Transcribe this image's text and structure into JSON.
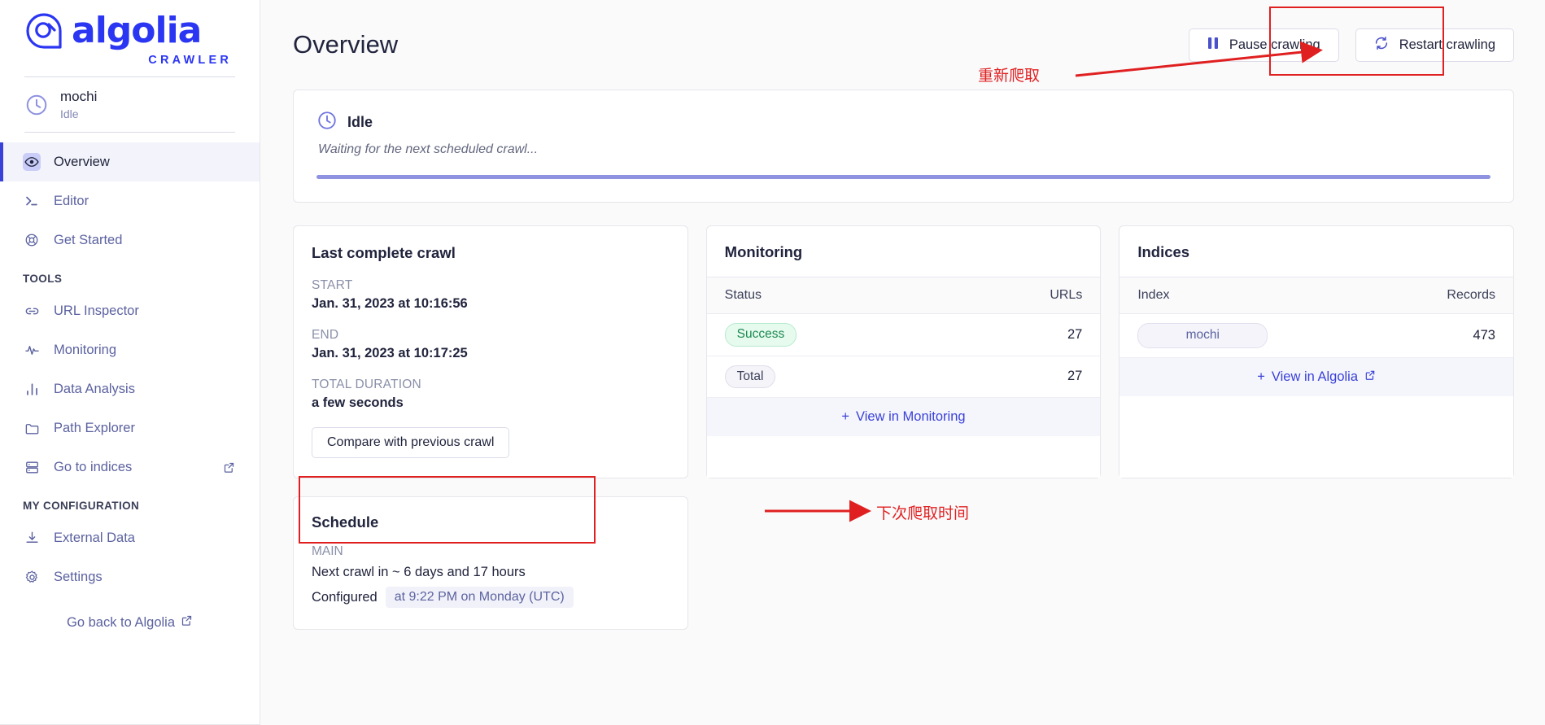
{
  "sidebar": {
    "logo_word": "algolia",
    "logo_sub": "CRAWLER",
    "crawler": {
      "name": "mochi",
      "status": "Idle"
    },
    "nav": [
      {
        "label": "Overview",
        "icon": "eye-icon",
        "active": true
      },
      {
        "label": "Editor",
        "icon": "terminal-icon",
        "active": false
      },
      {
        "label": "Get Started",
        "icon": "lifebuoy-icon",
        "active": false
      }
    ],
    "tools_section": "TOOLS",
    "tools": [
      {
        "label": "URL Inspector",
        "icon": "link-icon",
        "external": false
      },
      {
        "label": "Monitoring",
        "icon": "activity-icon",
        "external": false
      },
      {
        "label": "Data Analysis",
        "icon": "bar-chart-icon",
        "external": false
      },
      {
        "label": "Path Explorer",
        "icon": "folder-icon",
        "external": false
      },
      {
        "label": "Go to indices",
        "icon": "database-icon",
        "external": true
      }
    ],
    "config_section": "MY CONFIGURATION",
    "config": [
      {
        "label": "External Data",
        "icon": "download-icon",
        "external": false
      },
      {
        "label": "Settings",
        "icon": "gear-icon",
        "external": false
      }
    ],
    "go_back": "Go back to Algolia"
  },
  "header": {
    "title": "Overview",
    "pause_label": "Pause crawling",
    "restart_label": "Restart crawling"
  },
  "status": {
    "title": "Idle",
    "subtitle": "Waiting for the next scheduled crawl...",
    "progress_percent": 100
  },
  "last_crawl": {
    "title": "Last complete crawl",
    "start_label": "START",
    "start_value": "Jan. 31, 2023 at 10:16:56",
    "end_label": "END",
    "end_value": "Jan. 31, 2023 at 10:17:25",
    "duration_label": "TOTAL DURATION",
    "duration_value": "a few seconds",
    "compare_button": "Compare with previous crawl"
  },
  "monitoring": {
    "title": "Monitoring",
    "columns": [
      "Status",
      "URLs"
    ],
    "rows": [
      {
        "status": "Success",
        "urls": "27",
        "kind": "success"
      },
      {
        "status": "Total",
        "urls": "27",
        "kind": "total"
      }
    ],
    "view_link": "View in Monitoring"
  },
  "indices": {
    "title": "Indices",
    "columns": [
      "Index",
      "Records"
    ],
    "rows": [
      {
        "index": "mochi",
        "records": "473"
      }
    ],
    "view_link": "View in Algolia"
  },
  "schedule": {
    "title": "Schedule",
    "main_label": "MAIN",
    "next_crawl": "Next crawl in ~ 6 days and 17 hours",
    "configured_label": "Configured",
    "configured_value": "at 9:22 PM on Monday (UTC)"
  },
  "annotations": {
    "color": "#e02020",
    "restart_note": "重新爬取",
    "schedule_note": "下次爬取时间"
  }
}
